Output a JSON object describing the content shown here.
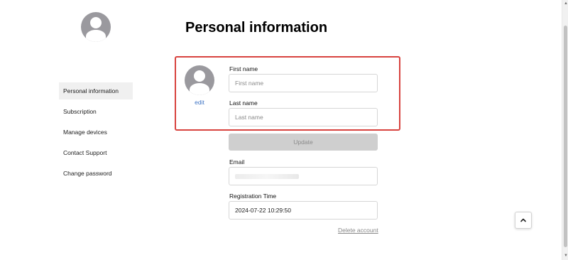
{
  "sidebar": {
    "avatar_icon": "user-avatar-icon",
    "items": [
      {
        "label": "Personal information",
        "active": true
      },
      {
        "label": "Subscription",
        "active": false
      },
      {
        "label": "Manage devices",
        "active": false
      },
      {
        "label": "Contact Support",
        "active": false
      },
      {
        "label": "Change password",
        "active": false
      }
    ]
  },
  "main": {
    "title": "Personal information",
    "highlight_color": "#d8433f",
    "profile": {
      "avatar_icon": "user-avatar-icon",
      "edit_label": "edit"
    },
    "first_name": {
      "label": "First name",
      "value": "",
      "placeholder": "First name"
    },
    "last_name": {
      "label": "Last name",
      "value": "",
      "placeholder": "Last name"
    },
    "update_label": "Update",
    "email": {
      "label": "Email"
    },
    "registration": {
      "label": "Registration Time",
      "value": "2024-07-22 10:29:50"
    },
    "delete_label": "Delete account"
  },
  "back_to_top_icon": "chevron-up-icon",
  "colors": {
    "link": "#3f74c4",
    "avatar": "#9a999e",
    "button_disabled": "#cfcfcf"
  }
}
